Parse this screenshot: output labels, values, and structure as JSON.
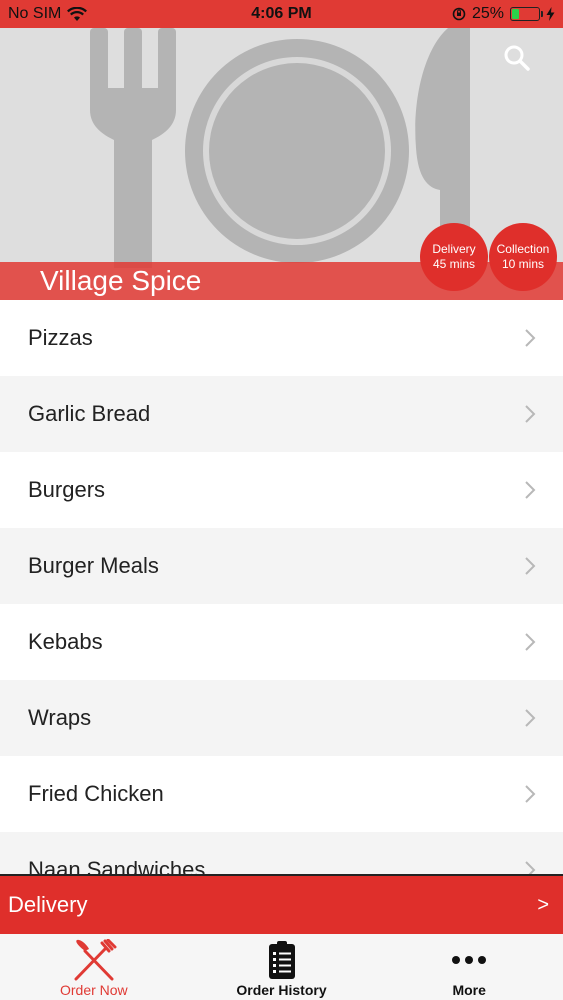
{
  "status_bar": {
    "carrier": "No SIM",
    "time": "4:06 PM",
    "battery": "25%",
    "battery_level": 0.25
  },
  "hero": {
    "restaurant_name": "Village Spice",
    "badges": [
      {
        "label": "Delivery",
        "value": "45 mins"
      },
      {
        "label": "Collection",
        "value": "10 mins"
      }
    ]
  },
  "categories": [
    "Pizzas",
    "Garlic Bread",
    "Burgers",
    "Burger Meals",
    "Kebabs",
    "Wraps",
    "Fried Chicken",
    "Naan Sandwiches"
  ],
  "delivery_bar": {
    "label": "Delivery",
    "arrow": ">"
  },
  "tabs": [
    {
      "label": "Order Now",
      "icon": "fork-knife-icon",
      "active": true
    },
    {
      "label": "Order History",
      "icon": "clipboard-list-icon",
      "active": false
    },
    {
      "label": "More",
      "icon": "more-dots-icon",
      "active": false
    }
  ],
  "colors": {
    "accent": "#e03a34",
    "badge": "#df2f2b"
  }
}
